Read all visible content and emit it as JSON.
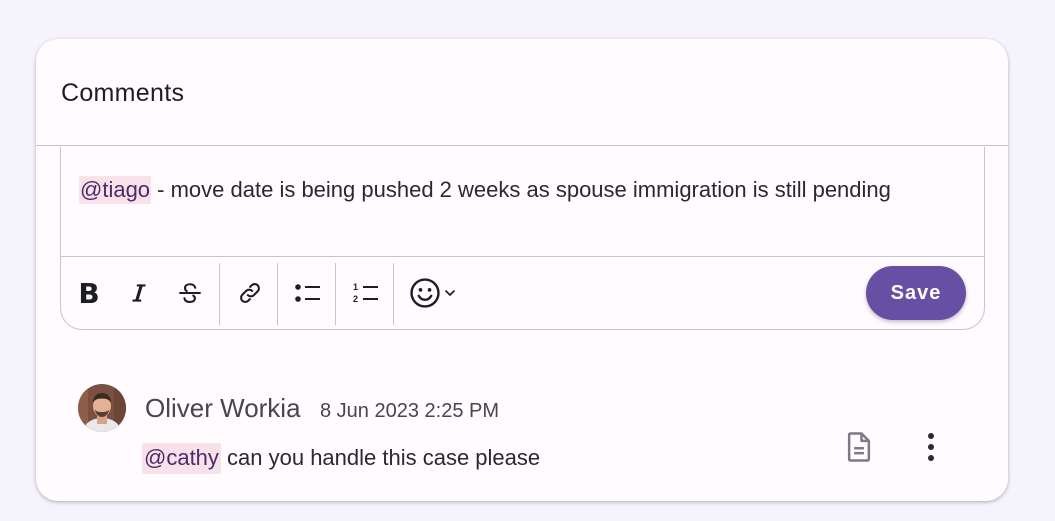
{
  "card": {
    "title": "Comments"
  },
  "editor": {
    "mention": "@tiago",
    "text": " - move date is being pushed 2 weeks as spouse immigration is still pending"
  },
  "toolbar": {
    "items": [
      {
        "name": "bold-button",
        "icon": "bold-icon"
      },
      {
        "name": "italic-button",
        "icon": "italic-icon"
      },
      {
        "name": "strikethrough-button",
        "icon": "strikethrough-icon"
      },
      {
        "name": "link-button",
        "icon": "link-icon"
      },
      {
        "name": "bullet-list-button",
        "icon": "bullet-list-icon"
      },
      {
        "name": "numbered-list-button",
        "icon": "numbered-list-icon"
      },
      {
        "name": "emoji-button",
        "icon": "emoji-icon"
      }
    ],
    "save_label": "Save"
  },
  "comment": {
    "author": "Oliver Workia",
    "timestamp": "8 Jun 2023 2:25 PM",
    "mention": "@cathy",
    "text": " can you handle this case please"
  },
  "colors": {
    "accent": "#6750a4",
    "mention_bg": "#f7e2ea",
    "outline": "#cac4d0",
    "surface": "#fffbff"
  }
}
